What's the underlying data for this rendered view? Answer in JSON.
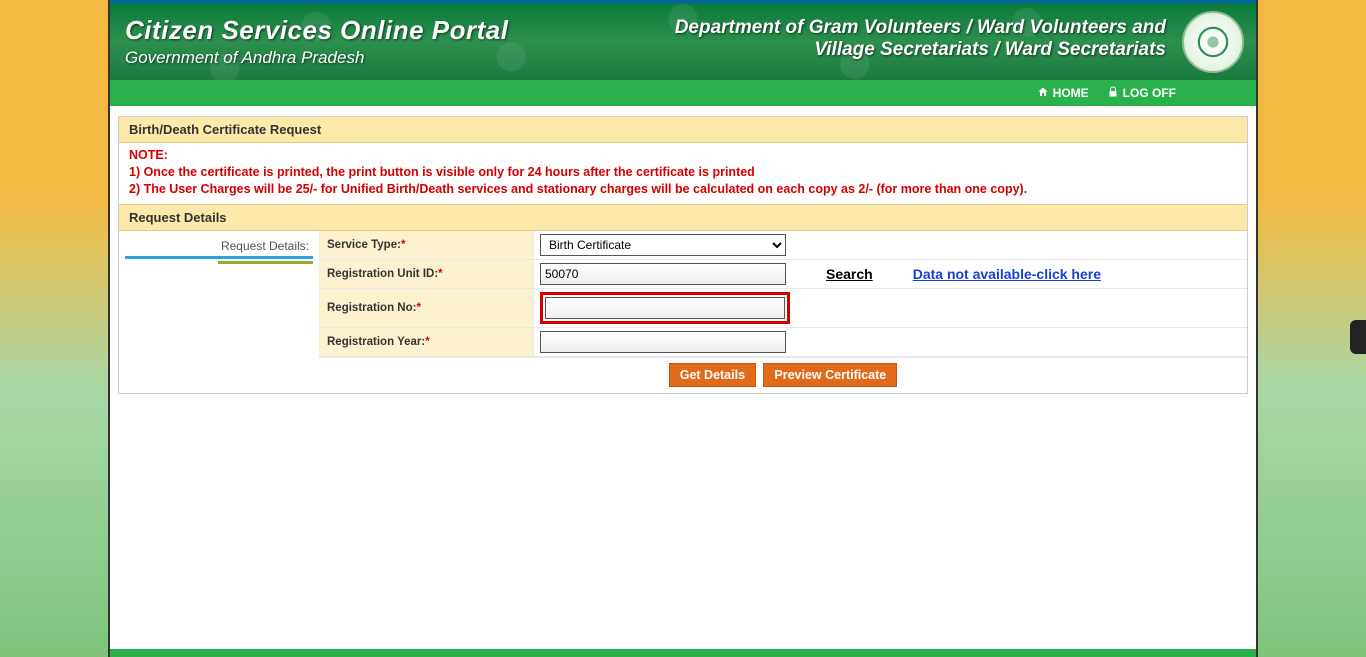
{
  "header": {
    "title": "Citizen Services Online Portal",
    "subtitle": "Government of Andhra Pradesh",
    "dept_line1": "Department of Gram Volunteers / Ward Volunteers and",
    "dept_line2": "Village Secretariats / Ward Secretariats"
  },
  "nav": {
    "home": "HOME",
    "logoff": "LOG OFF"
  },
  "panel": {
    "title": "Birth/Death Certificate Request",
    "note_heading": "NOTE:",
    "note1": "1) Once the certificate is printed, the print button is visible only for 24 hours after the certificate is printed",
    "note2": "2) The User Charges will be 25/- for Unified Birth/Death services and stationary charges will be calculated on each copy as 2/- (for more than one copy).",
    "section_title": "Request Details",
    "side_label": "Request Details:"
  },
  "form": {
    "service_type_label": "Service Type:",
    "service_type_value": "Birth Certificate",
    "reg_unit_label": "Registration Unit ID:",
    "reg_unit_value": "50070",
    "search_link": "Search",
    "na_link": "Data not available-click here",
    "reg_no_label": "Registration No:",
    "reg_no_value": "",
    "reg_year_label": "Registration Year:",
    "reg_year_value": ""
  },
  "buttons": {
    "get_details": "Get Details",
    "preview": "Preview Certificate"
  }
}
